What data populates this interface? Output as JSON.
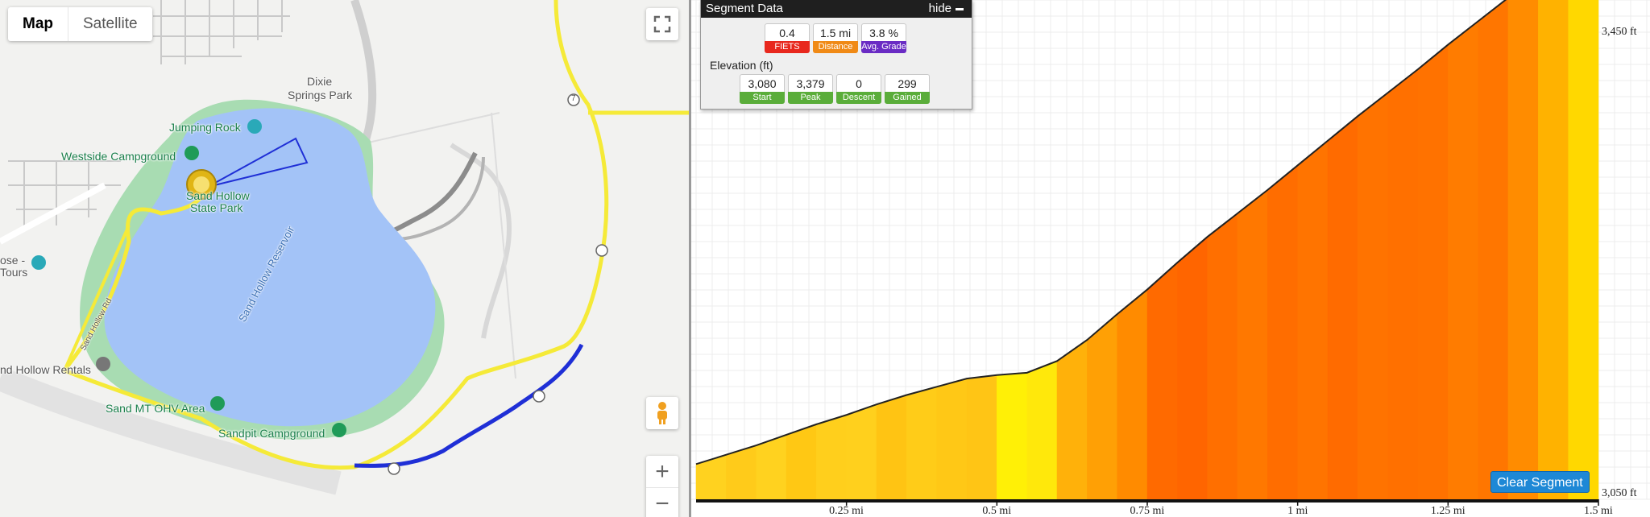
{
  "map": {
    "type_tabs": [
      {
        "label": "Map",
        "active": true
      },
      {
        "label": "Satellite",
        "active": false
      }
    ],
    "labels": {
      "dixie_1": "Dixie",
      "dixie_2": "Springs Park",
      "jumping_rock": "Jumping Rock",
      "westside": "Westside Campground",
      "park_1": "Sand Hollow",
      "park_2": "State Park",
      "reservoir": "Sand Hollow Reservoir",
      "tours_1": "ose -",
      "tours_2": "Tours",
      "rentals": "nd Hollow Rentals",
      "ohv": "Sand MT OHV Area",
      "sandpit": "Sandpit Campground",
      "road_name": "Sand Hollow Rd",
      "route_7": "7"
    },
    "colors": {
      "water": "#a3c3f7",
      "park": "#a8dcb2",
      "route": "#f5ea38",
      "segment": "#1f2fd6"
    }
  },
  "segment_panel": {
    "title": "Segment Data",
    "hide_label": "hide",
    "stats": [
      {
        "value": "0.4",
        "label": "FIETS",
        "color": "#e8281e"
      },
      {
        "value": "1.5 mi",
        "label": "Distance",
        "color": "#f08a16"
      },
      {
        "value": "3.8 %",
        "label": "Avg. Grade",
        "color": "#6a2cc4"
      }
    ],
    "elevation_title": "Elevation (ft)",
    "elevation": [
      {
        "value": "3,080",
        "label": "Start",
        "color": "#5aad3a"
      },
      {
        "value": "3,379",
        "label": "Peak",
        "color": "#5aad3a"
      },
      {
        "value": "0",
        "label": "Descent",
        "color": "#5aad3a"
      },
      {
        "value": "299",
        "label": "Gained",
        "color": "#5aad3a"
      }
    ]
  },
  "chart_data": {
    "type": "area",
    "y_tick_labels": [
      "3,450 ft",
      "3,050 ft"
    ],
    "ylim": [
      3050,
      3450
    ],
    "xlim": [
      0,
      1.5
    ],
    "x_tick_labels": [
      "0.25 mi",
      "0.5 mi",
      "0.75 mi",
      "1 mi",
      "1.25 mi",
      "1.5 mi"
    ],
    "x_ticks": [
      0.25,
      0.5,
      0.75,
      1.0,
      1.25,
      1.5
    ],
    "grid": true,
    "x": [
      0,
      0.05,
      0.1,
      0.15,
      0.2,
      0.25,
      0.3,
      0.35,
      0.4,
      0.45,
      0.5,
      0.55,
      0.6,
      0.65,
      0.7,
      0.75,
      0.8,
      0.85,
      0.9,
      0.95,
      1.0,
      1.05,
      1.1,
      1.15,
      1.2,
      1.25,
      1.3,
      1.35,
      1.4,
      1.45,
      1.5
    ],
    "y": [
      3080,
      3088,
      3096,
      3105,
      3114,
      3122,
      3131,
      3139,
      3146,
      3153,
      3156,
      3158,
      3168,
      3186,
      3208,
      3229,
      3252,
      3274,
      3294,
      3314,
      3335,
      3356,
      3377,
      3397,
      3417,
      3438,
      3458,
      3478,
      3494,
      3502,
      3505
    ],
    "fill_colors": [
      "#ffd21f",
      "#ffcb1a",
      "#ffd21f",
      "#ffc814",
      "#ffcf1c",
      "#ffd01d",
      "#ffc413",
      "#ffcc18",
      "#ffc816",
      "#ffc515",
      "#fff006",
      "#ffe80b",
      "#ffb10a",
      "#ffa005",
      "#ff8b00",
      "#ff6a00",
      "#ff6500",
      "#ff6f00",
      "#ff7800",
      "#ff6d00",
      "#ff7400",
      "#ff6b00",
      "#ff7300",
      "#ff7000",
      "#ff7200",
      "#ff7c00",
      "#ff7600",
      "#ff8c00",
      "#ffb200",
      "#ffd800",
      "#ffe100"
    ],
    "clear_button_label": "Clear Segment"
  }
}
